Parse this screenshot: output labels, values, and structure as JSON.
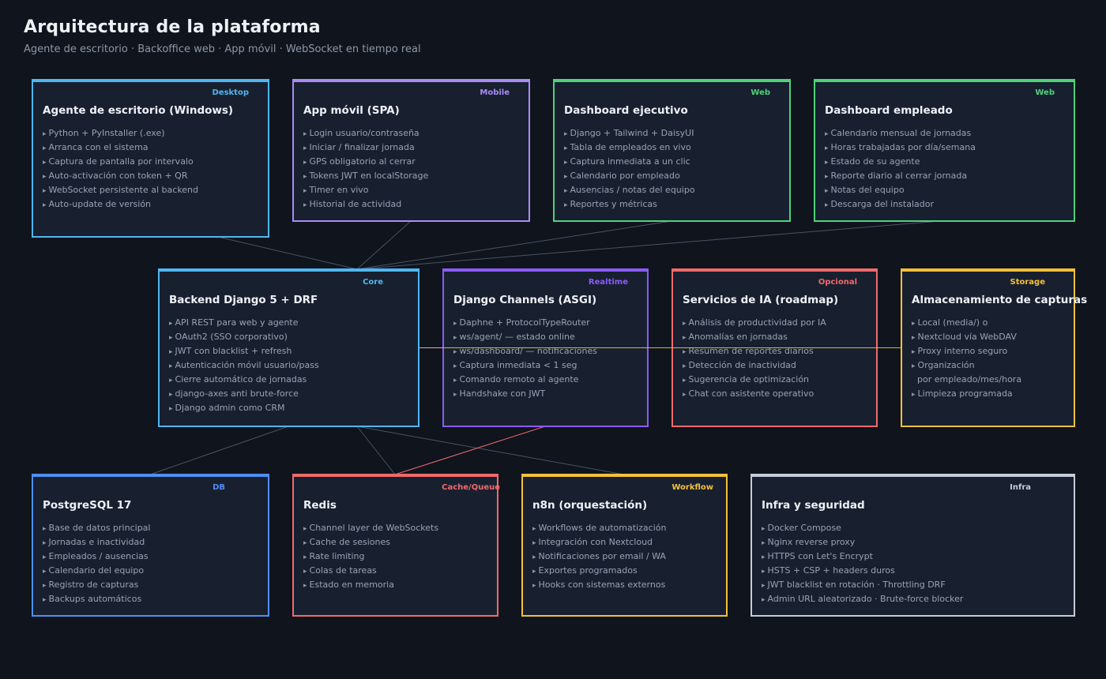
{
  "header": {
    "title": "Arquitectura de la plataforma",
    "subtitle": "Agente de escritorio · Backoffice web · App móvil · WebSocket en tiempo real"
  },
  "colors": {
    "background": "#0f141d",
    "card": "#182030",
    "sky": "#4fb6f0",
    "lavender": "#a98cf6",
    "green": "#4fd27a",
    "violet": "#8b5cf6",
    "coral": "#f06a6a",
    "amber": "#f5c03a",
    "blue": "#4f8ff0",
    "slate": "#c3ccd8"
  },
  "nodes": {
    "desktop": {
      "tag": "Desktop",
      "title": "Agente de escritorio (Windows)",
      "items": [
        "Python + PyInstaller (.exe)",
        "Arranca con el sistema",
        "Captura de pantalla por intervalo",
        "Auto-activación con token + QR",
        "WebSocket persistente al backend",
        "Auto-update de versión"
      ]
    },
    "mobile": {
      "tag": "Mobile",
      "title": "App móvil (SPA)",
      "items": [
        "Login usuario/contraseña",
        "Iniciar / finalizar jornada",
        "GPS obligatorio al cerrar",
        "Tokens JWT en localStorage",
        "Timer en vivo",
        "Historial de actividad"
      ]
    },
    "exec": {
      "tag": "Web",
      "title": "Dashboard ejecutivo",
      "items": [
        "Django + Tailwind + DaisyUI",
        "Tabla de empleados en vivo",
        "Captura inmediata a un clic",
        "Calendario por empleado",
        "Ausencias / notas del equipo",
        "Reportes y métricas"
      ]
    },
    "employee": {
      "tag": "Web",
      "title": "Dashboard empleado",
      "items": [
        "Calendario mensual de jornadas",
        "Horas trabajadas por día/semana",
        "Estado de su agente",
        "Reporte diario al cerrar jornada",
        "Notas del equipo",
        "Descarga del instalador"
      ]
    },
    "backend": {
      "tag": "Core",
      "title": "Backend Django 5 + DRF",
      "items": [
        "API REST para web y agente",
        "OAuth2 (SSO corporativo)",
        "JWT con blacklist + refresh",
        "Autenticación móvil usuario/pass",
        "Cierre automático de jornadas",
        "django-axes anti brute-force",
        "Django admin como CRM"
      ]
    },
    "channels": {
      "tag": "Realtime",
      "title": "Django Channels (ASGI)",
      "items": [
        "Daphne + ProtocolTypeRouter",
        "ws/agent/ — estado online",
        "ws/dashboard/ — notificaciones",
        "Captura inmediata < 1 seg",
        "Comando remoto al agente",
        "Handshake con JWT"
      ]
    },
    "ai": {
      "tag": "Opcional",
      "title": "Servicios de IA (roadmap)",
      "items": [
        "Análisis de productividad por IA",
        "Anomalías en jornadas",
        "Resumen de reportes diarios",
        "Detección de inactividad",
        "Sugerencia de optimización",
        "Chat con asistente operativo"
      ]
    },
    "storage": {
      "tag": "Storage",
      "title": "Almacenamiento de capturas",
      "items": [
        "Local (media/) o",
        "Nextcloud vía WebDAV",
        "Proxy interno seguro",
        "Organización",
        "por empleado/mes/hora",
        "Limpieza programada"
      ]
    },
    "postgres": {
      "tag": "DB",
      "title": "PostgreSQL 17",
      "items": [
        "Base de datos principal",
        "Jornadas e inactividad",
        "Empleados / ausencias",
        "Calendario del equipo",
        "Registro de capturas",
        "Backups automáticos"
      ]
    },
    "redis": {
      "tag": "Cache/Queue",
      "title": "Redis",
      "items": [
        "Channel layer de WebSockets",
        "Cache de sesiones",
        "Rate limiting",
        "Colas de tareas",
        "Estado en memoria"
      ]
    },
    "n8n": {
      "tag": "Workflow",
      "title": "n8n (orquestación)",
      "items": [
        "Workflows de automatización",
        "Integración con Nextcloud",
        "Notificaciones por email / WA",
        "Exportes programados",
        "Hooks con sistemas externos"
      ]
    },
    "infra": {
      "tag": "Infra",
      "title": "Infra y seguridad",
      "items": [
        "Docker Compose",
        "Nginx reverse proxy",
        "HTTPS con Let's Encrypt",
        "HSTS + CSP + headers duros",
        "JWT blacklist en rotación · Throttling DRF",
        "Admin URL aleatorizado · Brute-force blocker"
      ]
    }
  }
}
